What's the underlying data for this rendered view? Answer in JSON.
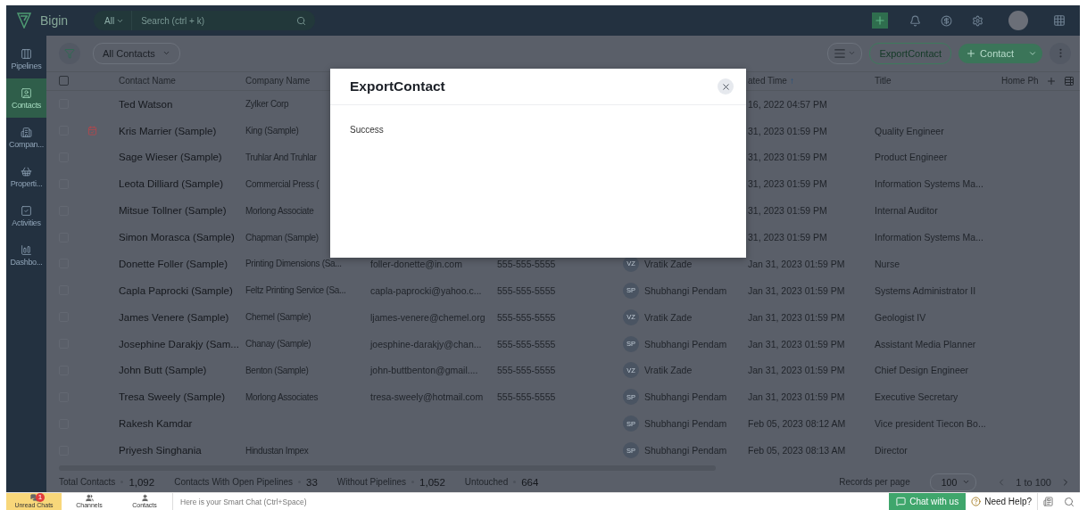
{
  "topbar": {
    "app_name": "Bigin",
    "search_scope": "All",
    "search": {
      "placeholder": "Search (ctrl + k)"
    }
  },
  "sidebar": {
    "items": [
      {
        "label": "Pipelines",
        "selected": false
      },
      {
        "label": "Contacts",
        "selected": true
      },
      {
        "label": "Compan...",
        "selected": false
      },
      {
        "label": "Properti...",
        "selected": false
      },
      {
        "label": "Activities",
        "selected": false
      },
      {
        "label": "Dashbo...",
        "selected": false
      }
    ]
  },
  "toolbar": {
    "view": "All Contacts",
    "export_button": "ExportContact",
    "add_button": "Contact"
  },
  "table": {
    "header_checked": false,
    "columns": [
      "Contact Name",
      "Company Name",
      null,
      null,
      null,
      "ated Time",
      "Title",
      "Home Ph"
    ],
    "sort_arrow": "↑",
    "rows": [
      {
        "checked": false,
        "has_activity": false,
        "name": "Ted Watson",
        "company": "Zylker Corp",
        "email": null,
        "phone": null,
        "owner_initials": null,
        "owner": null,
        "created": "16, 2022 04:57 PM",
        "title": null
      },
      {
        "checked": false,
        "has_activity": true,
        "name": "Kris Marrier (Sample)",
        "company": "King (Sample)",
        "email": null,
        "phone": null,
        "owner_initials": null,
        "owner": null,
        "created": "31, 2023 01:59 PM",
        "title": "Quality Engineer"
      },
      {
        "checked": false,
        "has_activity": false,
        "name": "Sage Wieser (Sample)",
        "company": "Truhlar And Truhlar",
        "email": null,
        "phone": null,
        "owner_initials": null,
        "owner": null,
        "created": "31, 2023 01:59 PM",
        "title": "Product Engineer"
      },
      {
        "checked": false,
        "has_activity": false,
        "name": "Leota Dilliard (Sample)",
        "company": "Commercial Press (",
        "email": null,
        "phone": null,
        "owner_initials": null,
        "owner": null,
        "created": "31, 2023 01:59 PM",
        "title": "Information Systems Ma..."
      },
      {
        "checked": false,
        "has_activity": false,
        "name": "Mitsue Tollner (Sample)",
        "company": "Morlong Associate",
        "email": null,
        "phone": null,
        "owner_initials": null,
        "owner": null,
        "created": "31, 2023 01:59 PM",
        "title": "Internal Auditor"
      },
      {
        "checked": false,
        "has_activity": false,
        "name": "Simon Morasca (Sample)",
        "company": "Chapman (Sample)",
        "email": null,
        "phone": null,
        "owner_initials": null,
        "owner": null,
        "created": "31, 2023 01:59 PM",
        "title": "Information Systems Ma..."
      },
      {
        "checked": false,
        "has_activity": false,
        "name": "Donette Foller (Sample)",
        "company": "Printing Dimensions (Sa...",
        "email": "foller-donette@in.com",
        "phone": "555-555-5555",
        "owner_initials": "VZ",
        "owner": "Vratik Zade",
        "created": "Jan 31, 2023 01:59 PM",
        "title": "Nurse"
      },
      {
        "checked": false,
        "has_activity": false,
        "name": "Capla Paprocki (Sample)",
        "company": "Feltz Printing Service (Sa...",
        "email": "capla-paprocki@yahoo.c...",
        "phone": "555-555-5555",
        "owner_initials": "SP",
        "owner": "Shubhangi Pendam",
        "created": "Jan 31, 2023 01:59 PM",
        "title": "Systems Administrator II"
      },
      {
        "checked": false,
        "has_activity": false,
        "name": "James Venere (Sample)",
        "company": "Chemel (Sample)",
        "email": "ljames-venere@chemel.org",
        "phone": "555-555-5555",
        "owner_initials": "VZ",
        "owner": "Vratik Zade",
        "created": "Jan 31, 2023 01:59 PM",
        "title": "Geologist IV"
      },
      {
        "checked": false,
        "has_activity": false,
        "name": "Josephine Darakjy (Sam...",
        "company": "Chanay (Sample)",
        "email": "joesphine-darakjy@chan...",
        "phone": "555-555-5555",
        "owner_initials": "SP",
        "owner": "Shubhangi Pendam",
        "created": "Jan 31, 2023 01:59 PM",
        "title": "Assistant Media Planner"
      },
      {
        "checked": false,
        "has_activity": false,
        "name": "John Butt (Sample)",
        "company": "Benton (Sample)",
        "email": "john-buttbenton@gmail....",
        "phone": "555-555-5555",
        "owner_initials": "VZ",
        "owner": "Vratik Zade",
        "created": "Jan 31, 2023 01:59 PM",
        "title": "Chief Design Engineer"
      },
      {
        "checked": false,
        "has_activity": false,
        "name": "Tresa Sweely (Sample)",
        "company": "Morlong Associates",
        "email": "tresa-sweely@hotmail.com",
        "phone": "555-555-5555",
        "owner_initials": "SP",
        "owner": "Shubhangi Pendam",
        "created": "Jan 31, 2023 01:59 PM",
        "title": "Executive Secretary"
      },
      {
        "checked": false,
        "has_activity": false,
        "name": "Rakesh Kamdar",
        "company": null,
        "email": null,
        "phone": null,
        "owner_initials": "SP",
        "owner": "Shubhangi Pendam",
        "created": "Feb 05, 2023 08:12 AM",
        "title": "Vice president Tiecon Bo..."
      },
      {
        "checked": false,
        "has_activity": false,
        "name": "Priyesh Singhania",
        "company": "Hindustan Impex",
        "email": null,
        "phone": null,
        "owner_initials": "SP",
        "owner": "Shubhangi Pendam",
        "created": "Feb 05, 2023 08:13 AM",
        "title": "Director"
      }
    ]
  },
  "footer": {
    "stats": [
      {
        "label": "Total Contacts",
        "value": "1,092"
      },
      {
        "label": "Contacts With Open Pipelines",
        "value": "33"
      },
      {
        "label": "Without Pipelines",
        "value": "1,052"
      },
      {
        "label": "Untouched",
        "value": "664"
      }
    ],
    "records_label": "Records per page",
    "records_per_page": "100",
    "range": "1 to 100"
  },
  "dialog": {
    "title": "ExportContact",
    "message": "Success"
  },
  "chatbar": {
    "tabs": [
      {
        "label": "Unread Chats",
        "badge": "1",
        "selected": true
      },
      {
        "label": "Channels",
        "selected": false
      },
      {
        "label": "Contacts",
        "selected": false
      }
    ],
    "input": {
      "placeholder": "Here is your Smart Chat (Ctrl+Space)"
    },
    "chat_button": "Chat with us",
    "help_button": "Need Help?"
  }
}
